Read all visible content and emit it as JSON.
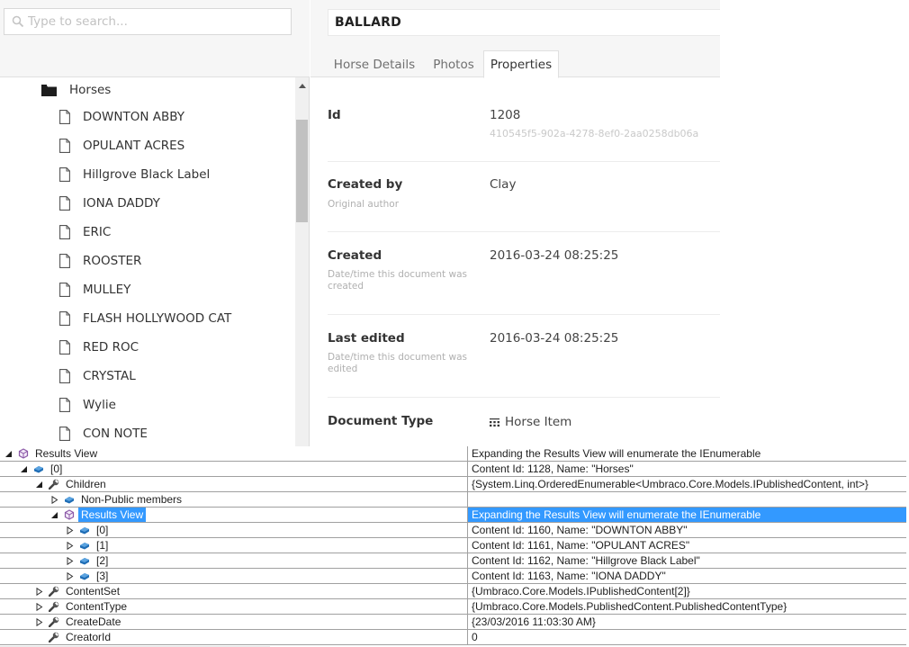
{
  "search": {
    "placeholder": "Type to search..."
  },
  "tree": {
    "folder": {
      "label": "Horses",
      "icon": "folder-icon"
    },
    "items": [
      {
        "label": "DOWNTON ABBY",
        "icon": "document-icon"
      },
      {
        "label": "OPULANT ACRES",
        "icon": "document-icon"
      },
      {
        "label": "Hillgrove Black Label",
        "icon": "document-icon"
      },
      {
        "label": "IONA DADDY",
        "icon": "document-icon"
      },
      {
        "label": "ERIC",
        "icon": "document-icon"
      },
      {
        "label": "ROOSTER",
        "icon": "document-icon"
      },
      {
        "label": "MULLEY",
        "icon": "document-icon"
      },
      {
        "label": "FLASH HOLLYWOOD CAT",
        "icon": "document-icon"
      },
      {
        "label": "RED ROC",
        "icon": "document-icon"
      },
      {
        "label": "CRYSTAL",
        "icon": "document-icon"
      },
      {
        "label": "Wylie",
        "icon": "document-icon"
      },
      {
        "label": "CON NOTE",
        "icon": "document-icon"
      }
    ]
  },
  "editor": {
    "name_value": "BALLARD",
    "tabs": [
      {
        "label": "Horse Details",
        "active": false
      },
      {
        "label": "Photos",
        "active": false
      },
      {
        "label": "Properties",
        "active": true
      }
    ],
    "properties": {
      "id": {
        "label": "Id",
        "value": "1208",
        "guid": "410545f5-902a-4278-8ef0-2aa0258db06a"
      },
      "created_by": {
        "label": "Created by",
        "description": "Original author",
        "value": "Clay"
      },
      "created": {
        "label": "Created",
        "description": "Date/time this document was created",
        "value": "2016-03-24 08:25:25"
      },
      "last_edited": {
        "label": "Last edited",
        "description": "Date/time this document was edited",
        "value": "2016-03-24 08:25:25"
      },
      "document_type": {
        "label": "Document Type",
        "value": "Horse Item",
        "icon": "grid-icon"
      }
    }
  },
  "watch": {
    "rows": [
      {
        "name": "Results View",
        "value": "Expanding the Results View will enumerate the IEnumerable",
        "indent": 0,
        "expander": "expanded",
        "icon": "results-view-icon",
        "selected": false
      },
      {
        "name": "[0]",
        "value": "Content Id: 1128, Name: \"Horses\"",
        "indent": 1,
        "expander": "expanded",
        "icon": "object-icon",
        "selected": false
      },
      {
        "name": "Children",
        "value": "{System.Linq.OrderedEnumerable<Umbraco.Core.Models.IPublishedContent, int>}",
        "indent": 2,
        "expander": "expanded",
        "icon": "property-wrench-icon",
        "selected": false
      },
      {
        "name": "Non-Public members",
        "value": "",
        "indent": 3,
        "expander": "collapsed",
        "icon": "object-icon",
        "selected": false
      },
      {
        "name": "Results View",
        "value": "Expanding the Results View will enumerate the IEnumerable",
        "indent": 3,
        "expander": "expanded",
        "icon": "results-view-icon",
        "selected": true
      },
      {
        "name": "[0]",
        "value": "Content Id: 1160, Name: \"DOWNTON ABBY\"",
        "indent": 4,
        "expander": "collapsed",
        "icon": "object-icon",
        "selected": false
      },
      {
        "name": "[1]",
        "value": "Content Id: 1161, Name: \"OPULANT ACRES\"",
        "indent": 4,
        "expander": "collapsed",
        "icon": "object-icon",
        "selected": false
      },
      {
        "name": "[2]",
        "value": "Content Id: 1162, Name: \"Hillgrove Black Label\"",
        "indent": 4,
        "expander": "collapsed",
        "icon": "object-icon",
        "selected": false
      },
      {
        "name": "[3]",
        "value": "Content Id: 1163, Name: \"IONA DADDY\"",
        "indent": 4,
        "expander": "collapsed",
        "icon": "object-icon",
        "selected": false
      },
      {
        "name": "ContentSet",
        "value": "{Umbraco.Core.Models.IPublishedContent[2]}",
        "indent": 2,
        "expander": "collapsed",
        "icon": "property-wrench-icon",
        "selected": false
      },
      {
        "name": "ContentType",
        "value": "{Umbraco.Core.Models.PublishedContent.PublishedContentType}",
        "indent": 2,
        "expander": "collapsed",
        "icon": "property-wrench-icon",
        "selected": false
      },
      {
        "name": "CreateDate",
        "value": "{23/03/2016 11:03:30 AM}",
        "indent": 2,
        "expander": "collapsed",
        "icon": "property-wrench-icon",
        "selected": false
      },
      {
        "name": "CreatorId",
        "value": "0",
        "indent": 2,
        "expander": "none",
        "icon": "property-wrench-icon",
        "selected": false
      }
    ]
  }
}
